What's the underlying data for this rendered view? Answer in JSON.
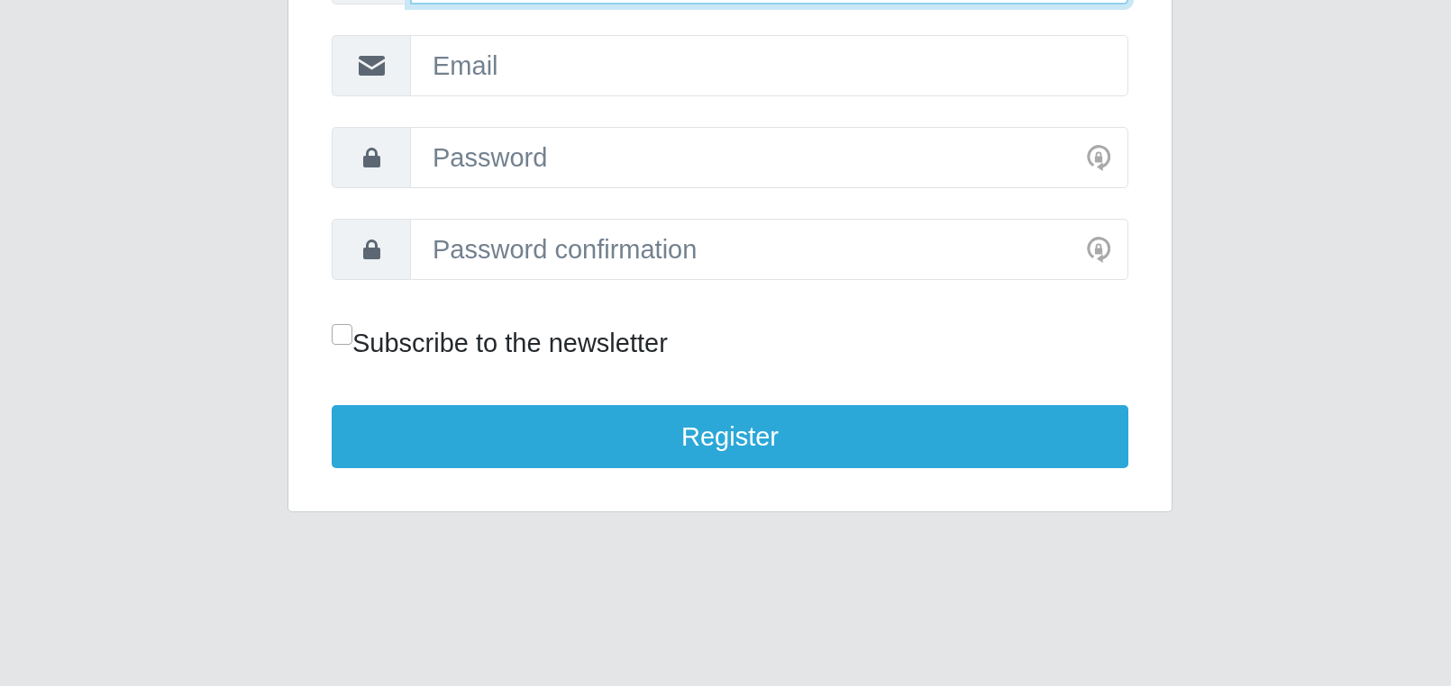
{
  "form": {
    "fields": [
      {
        "focused": true
      },
      {
        "kind": "email",
        "placeholder": "Email",
        "focused": false
      },
      {
        "kind": "password",
        "placeholder": "Password",
        "focused": false
      },
      {
        "kind": "password",
        "placeholder": "Password confirmation",
        "focused": false
      }
    ],
    "newsletter": {
      "label": "Subscribe to the newsletter",
      "checked": false
    },
    "submit": {
      "label": "Register"
    }
  }
}
